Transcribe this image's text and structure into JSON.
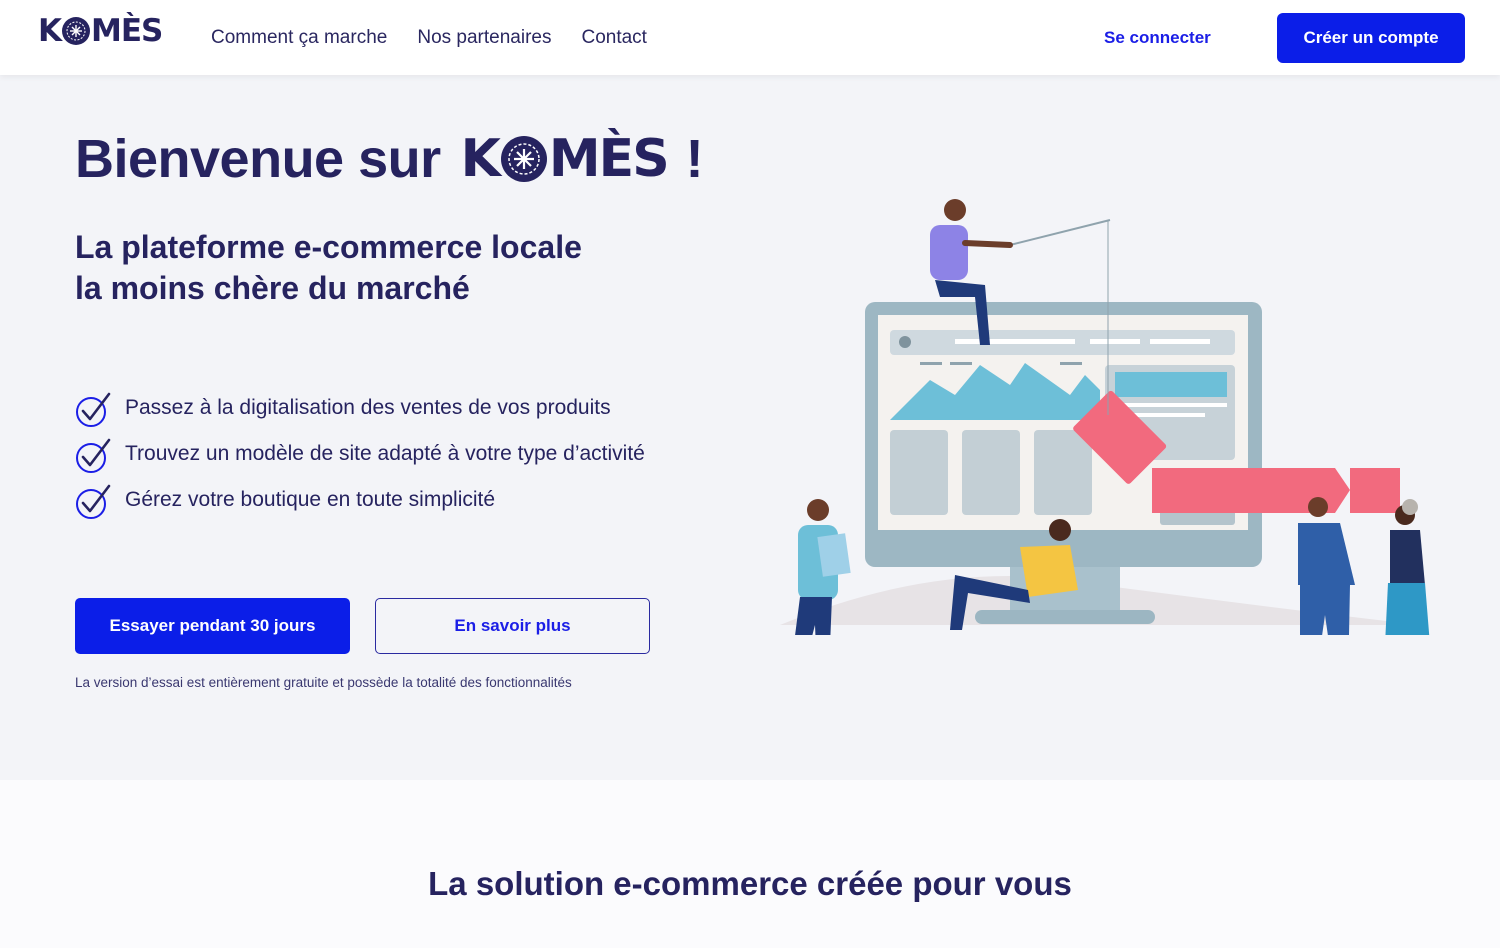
{
  "header": {
    "logo_alt": "KOMÈS",
    "nav": [
      {
        "label": "Comment ça marche"
      },
      {
        "label": "Nos partenaires"
      },
      {
        "label": "Contact"
      }
    ],
    "login_label": "Se connecter",
    "signup_label": "Créer un compte"
  },
  "hero": {
    "title_prefix": "Bienvenue sur",
    "title_suffix": "!",
    "subtitle_line1": "La plateforme e-commerce locale",
    "subtitle_line2": "la moins chère du marché",
    "features": [
      {
        "text": "Passez à la digitalisation des ventes de vos produits"
      },
      {
        "text": "Trouvez un modèle de site adapté à votre type d’activité"
      },
      {
        "text": "Gérez votre boutique en toute simplicité"
      }
    ],
    "try_button": "Essayer pendant 30 jours",
    "more_button": "En savoir plus",
    "note": "La version d’essai est entièrement gratuite et possède la totalité des fonctionnalités"
  },
  "section": {
    "title": "La solution e-commerce créée pour vous"
  },
  "colors": {
    "primary": "#0b1ee8",
    "navy": "#26235f",
    "hero_bg": "#f3f4f8",
    "accent_pink": "#f26a7e"
  }
}
